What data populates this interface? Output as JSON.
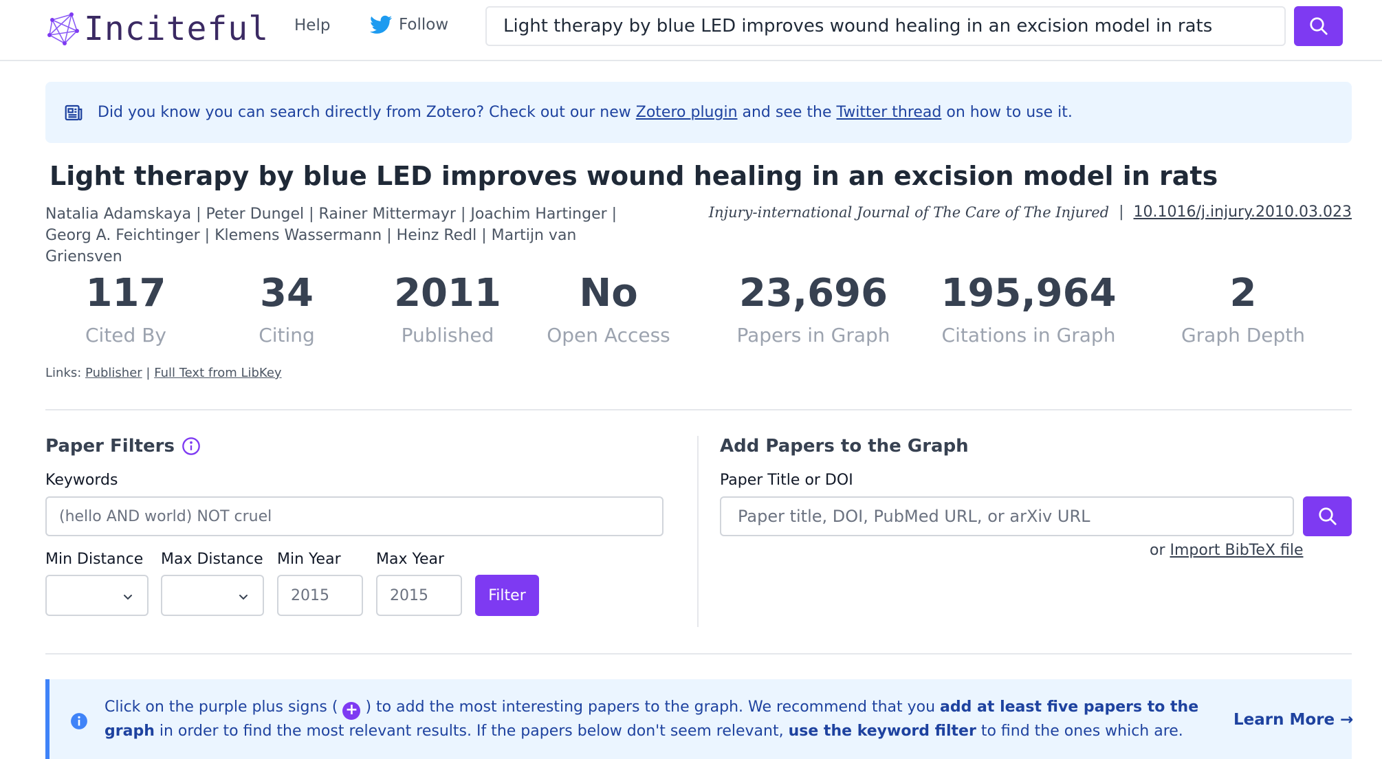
{
  "header": {
    "logo_text": "Inciteful",
    "nav_help": "Help",
    "nav_follow": "Follow",
    "search_value": "Light therapy by blue LED improves wound healing in an excision model in rats",
    "brand_color": "#7e3af2"
  },
  "banner": {
    "text_before": "Did you know you can search directly from Zotero? Check out our new ",
    "zotero_link": "Zotero plugin",
    "text_middle": " and see the ",
    "twitter_link": "Twitter thread",
    "text_after": " on how to use it."
  },
  "paper": {
    "title": "Light therapy by blue LED improves wound healing in an excision model in rats",
    "authors_line1": "Natalia Adamskaya | Peter Dungel | Rainer Mittermayr | Joachim Hartinger |",
    "authors_line2": "Georg A. Feichtinger | Klemens Wassermann | Heinz Redl | Martijn van Griensven",
    "journal": "Injury-international Journal of The Care of The Injured",
    "separator": "|",
    "doi": "10.1016/j.injury.2010.03.023"
  },
  "stats": [
    {
      "value": "117",
      "label": "Cited By"
    },
    {
      "value": "34",
      "label": "Citing"
    },
    {
      "value": "2011",
      "label": "Published"
    },
    {
      "value": "No",
      "label": "Open Access"
    },
    {
      "value": "23,696",
      "label": "Papers in Graph"
    },
    {
      "value": "195,964",
      "label": "Citations in Graph"
    },
    {
      "value": "2",
      "label": "Graph Depth"
    }
  ],
  "links": {
    "prefix": "Links:",
    "publisher": "Publisher",
    "separator": "|",
    "libkey": "Full Text from LibKey"
  },
  "filters": {
    "title": "Paper Filters",
    "keywords_label": "Keywords",
    "keywords_placeholder": "(hello AND world) NOT cruel",
    "min_distance_label": "Min Distance",
    "max_distance_label": "Max Distance",
    "min_year_label": "Min Year",
    "max_year_label": "Max Year",
    "min_year_placeholder": "2015",
    "max_year_placeholder": "2015",
    "filter_button": "Filter"
  },
  "add_papers": {
    "title": "Add Papers to the Graph",
    "field_label": "Paper Title or DOI",
    "placeholder": "Paper title, DOI, PubMed URL, or arXiv URL",
    "import_prefix": "or ",
    "import_link": "Import BibTeX file"
  },
  "info": {
    "text1": "Click on the purple plus signs ( ",
    "plus": "+",
    "text2": " ) to add the most interesting papers to the graph. We recommend that you ",
    "bold1": "add at least five papers to the graph",
    "text3": " in order to find the most relevant results. If the papers below don't seem relevant, ",
    "bold2": "use the keyword filter",
    "text4": " to find the ones which are.",
    "learn_more": "Learn More →"
  }
}
